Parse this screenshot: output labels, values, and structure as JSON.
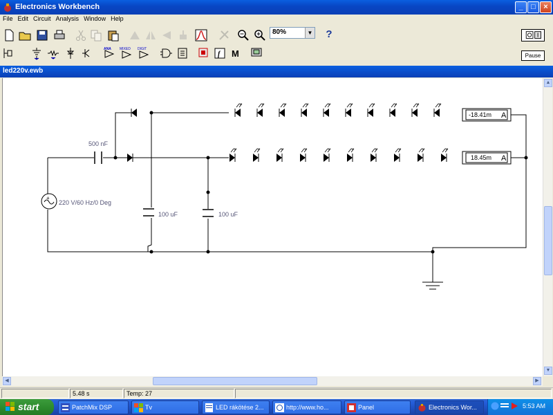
{
  "window": {
    "title": "Electronics Workbench",
    "buttons": {
      "minimize": "_",
      "maximize": "□",
      "close": "×"
    }
  },
  "menu": [
    "File",
    "Edit",
    "Circuit",
    "Analysis",
    "Window",
    "Help"
  ],
  "toolbar": {
    "zoom_value": "80%",
    "help_label": "?",
    "pause_label": "Pause",
    "bin_labels": {
      "analog": "ANA",
      "mixed": "MIXED",
      "digital": "DIGIT",
      "misc": "M",
      "func": "f"
    }
  },
  "document": {
    "title": "led220v.ewb"
  },
  "circuit": {
    "capacitor_series_label": "500 nF",
    "source_label": "220 V/60 Hz/0 Deg",
    "cap1_label": "100 uF",
    "cap2_label": "100 uF",
    "ammeter_top_value": "-18.41m",
    "ammeter_bottom_value": "18.45m",
    "ammeter_unit": "A",
    "top_led_count": 10,
    "bottom_led_count": 10
  },
  "statusbar": {
    "time": "5.48 s",
    "temp_label": "Temp:",
    "temp_value": "27"
  },
  "taskbar": {
    "start_label": "start",
    "tasks": [
      "PatchMix DSP",
      "Tv",
      "LED rákötése 2...",
      "http://www.ho...",
      "Panel",
      "Electronics Wor..."
    ],
    "clock": "5:53 AM"
  },
  "colors": {
    "title_blue": "#0846c4",
    "taskbar_blue": "#245edb",
    "wire": "#000000",
    "label_gray": "#555577"
  }
}
